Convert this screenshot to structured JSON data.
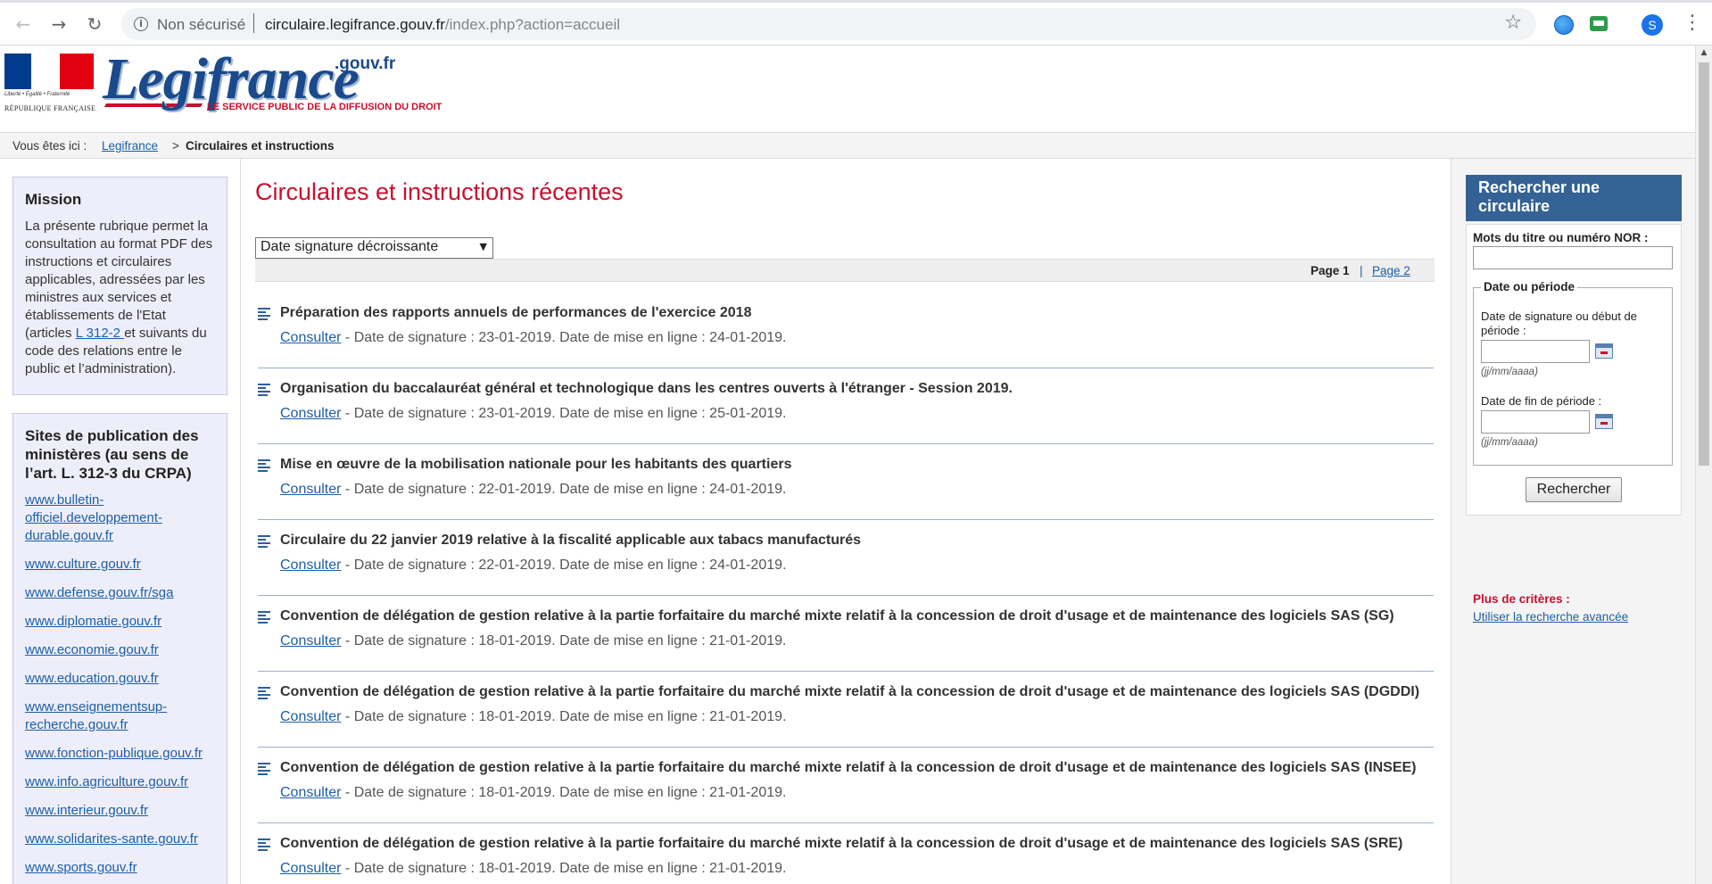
{
  "browser": {
    "security_label": "Non sécurisé",
    "url_domain": "circulaire.legifrance.gouv.fr",
    "url_path": "/index.php?action=accueil",
    "profile_initial": "S"
  },
  "header": {
    "motto": "Liberté • Égalité • Fraternité",
    "republic": "RÉPUBLIQUE FRANÇAISE",
    "logo_word": "Legifrance",
    "logo_suffix": ".gouv.fr",
    "tagline": "LE SERVICE PUBLIC DE LA DIFFUSION DU DROIT"
  },
  "breadcrumb": {
    "prefix": "Vous êtes ici :",
    "home": "Legifrance",
    "separator": ">",
    "current": "Circulaires et instructions"
  },
  "sidebar": {
    "mission_title": "Mission",
    "mission_text_before": "La présente rubrique permet la consultation au format PDF des instructions et circulaires applicables, adressées par les ministres aux services et établissements de l'Etat (articles",
    "mission_link": " L 312-2 ",
    "mission_text_after": "et suivants du code des relations entre le public et l’administration).",
    "sites_title": "Sites de publication des ministères (au sens de l’art. L. 312-3 du CRPA)",
    "sites": [
      "www.bulletin-officiel.developpement-durable.gouv.fr",
      "www.culture.gouv.fr",
      "www.defense.gouv.fr/sga",
      "www.diplomatie.gouv.fr",
      "www.economie.gouv.fr",
      "www.education.gouv.fr",
      "www.enseignementsup-recherche.gouv.fr",
      "www.fonction-publique.gouv.fr",
      "www.info.agriculture.gouv.fr",
      "www.interieur.gouv.fr",
      "www.solidarites-sante.gouv.fr",
      "www.sports.gouv.fr"
    ]
  },
  "main": {
    "title": "Circulaires et instructions récentes",
    "sort_value": "Date signature décroissante",
    "pager": {
      "current": "Page 1",
      "separator": "|",
      "next": "Page 2"
    },
    "consult_label": "Consulter",
    "results": [
      {
        "title": "Préparation des rapports annuels de performances de l'exercice 2018",
        "meta": " - Date de signature : 23-01-2019. Date de mise en ligne : 24-01-2019."
      },
      {
        "title": "Organisation du baccalauréat général et technologique dans les centres ouverts à l'étranger - Session 2019.",
        "meta": " - Date de signature : 23-01-2019. Date de mise en ligne : 25-01-2019."
      },
      {
        "title": "Mise en œuvre de la mobilisation nationale pour les habitants des quartiers",
        "meta": " - Date de signature : 22-01-2019. Date de mise en ligne : 24-01-2019."
      },
      {
        "title": "Circulaire du 22 janvier 2019 relative à la fiscalité applicable aux tabacs manufacturés",
        "meta": " - Date de signature : 22-01-2019. Date de mise en ligne : 24-01-2019."
      },
      {
        "title": "Convention de délégation de gestion relative à la partie forfaitaire du marché mixte relatif à la concession de droit d'usage et de maintenance des logiciels SAS (SG)",
        "meta": " - Date de signature : 18-01-2019. Date de mise en ligne : 21-01-2019."
      },
      {
        "title": "Convention de délégation de gestion relative à la partie forfaitaire du marché mixte relatif à la concession de droit d'usage et de maintenance des logiciels SAS (DGDDI)",
        "meta": " - Date de signature : 18-01-2019. Date de mise en ligne : 21-01-2019."
      },
      {
        "title": "Convention de délégation de gestion relative à la partie forfaitaire du marché mixte relatif à la concession de droit d'usage et de maintenance des logiciels SAS (INSEE)",
        "meta": " - Date de signature : 18-01-2019. Date de mise en ligne : 21-01-2019."
      },
      {
        "title": "Convention de délégation de gestion relative à la partie forfaitaire du marché mixte relatif à la concession de droit d'usage et de maintenance des logiciels SAS (SRE)",
        "meta": " - Date de signature : 18-01-2019. Date de mise en ligne : 21-01-2019."
      }
    ]
  },
  "search": {
    "title": "Rechercher une circulaire",
    "nor_label": "Mots du titre ou numéro NOR :",
    "period_legend": "Date ou période",
    "start_label": "Date de signature ou début de période :",
    "end_label": "Date de fin de période :",
    "date_hint": "(jj/mm/aaaa)",
    "button": "Rechercher",
    "more_label": "Plus de critères :",
    "advanced_link": "Utiliser la recherche avancée"
  },
  "colors": {
    "accent": "#c8102e",
    "link": "#1b5fa8",
    "search_header": "#346294"
  },
  "icons": [
    "back-arrow-icon",
    "forward-arrow-icon",
    "reload-icon",
    "info-icon",
    "star-icon",
    "menu-icon",
    "calendar-icon",
    "document-lines-icon"
  ]
}
